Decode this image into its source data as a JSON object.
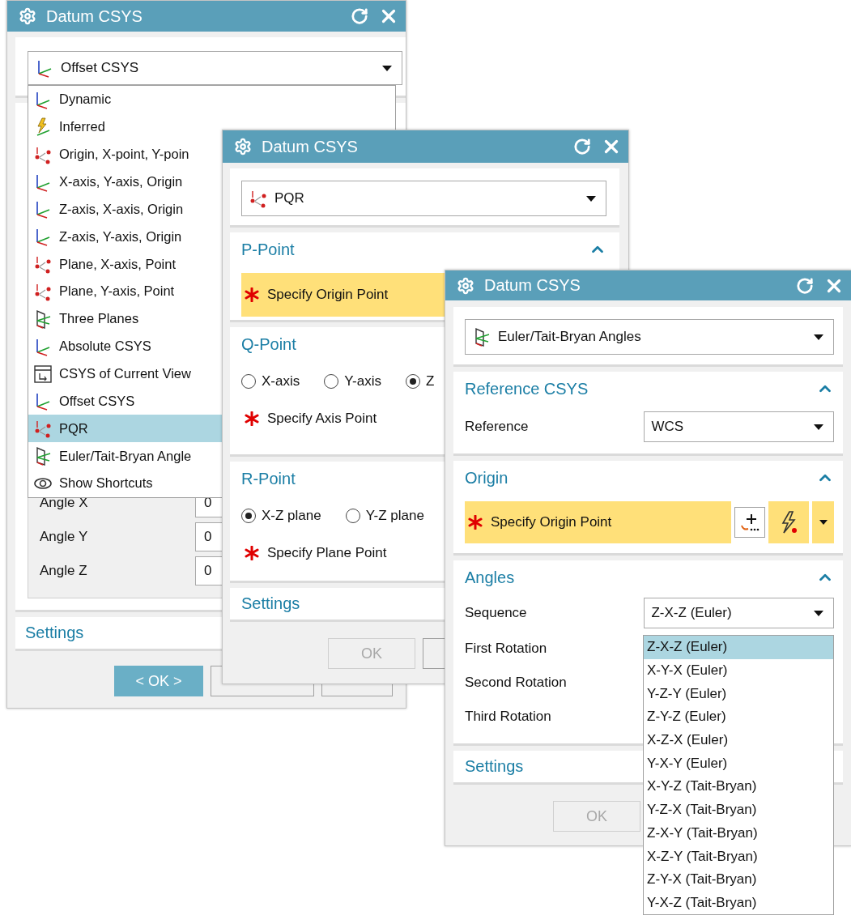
{
  "offset_window": {
    "title": "Datum CSYS",
    "type_value": "Offset CSYS",
    "type_list": [
      {
        "label": "Dynamic",
        "selected": false
      },
      {
        "label": "Inferred",
        "selected": false
      },
      {
        "label": "Origin, X-point, Y-poin",
        "selected": false
      },
      {
        "label": "X-axis, Y-axis, Origin",
        "selected": false
      },
      {
        "label": "Z-axis, X-axis, Origin",
        "selected": false
      },
      {
        "label": "Z-axis, Y-axis, Origin",
        "selected": false
      },
      {
        "label": "Plane, X-axis, Point",
        "selected": false
      },
      {
        "label": "Plane, Y-axis, Point",
        "selected": false
      },
      {
        "label": "Three Planes",
        "selected": false
      },
      {
        "label": "Absolute CSYS",
        "selected": false
      },
      {
        "label": "CSYS of Current View",
        "selected": false
      },
      {
        "label": "Offset CSYS",
        "selected": false
      },
      {
        "label": "PQR",
        "selected": true
      },
      {
        "label": "Euler/Tait-Bryan Angle",
        "selected": false
      },
      {
        "label": "Show Shortcuts",
        "selected": false
      }
    ],
    "angles": [
      {
        "label": "Angle X",
        "value": "0"
      },
      {
        "label": "Angle Y",
        "value": "0"
      },
      {
        "label": "Angle Z",
        "value": "0"
      }
    ],
    "settings_label": "Settings",
    "buttons": [
      {
        "label": "< OK >",
        "default": true
      },
      {
        "default": false
      },
      {
        "default": false
      }
    ]
  },
  "pqr_window": {
    "title": "Datum CSYS",
    "type_value": "PQR",
    "sections": [
      {
        "title": "P-Point",
        "expanded": true,
        "prompt": "Specify Origin Point",
        "active": true
      },
      {
        "title": "Q-Point",
        "options": [
          {
            "label": "X-axis",
            "selected": false
          },
          {
            "label": "Y-axis",
            "selected": false
          },
          {
            "label": "Z",
            "selected": true
          }
        ],
        "prompt": "Specify Axis Point",
        "active": false
      },
      {
        "title": "R-Point",
        "options": [
          {
            "label": "X-Z plane",
            "selected": true
          },
          {
            "label": "Y-Z plane",
            "selected": false
          }
        ],
        "prompt": "Specify Plane Point",
        "active": false
      }
    ],
    "settings_label": "Settings",
    "buttons": [
      {
        "label": "OK",
        "disabled": true
      },
      {
        "disabled": false
      }
    ]
  },
  "euler_window": {
    "title": "Datum CSYS",
    "type_value": "Euler/Tait-Bryan Angles",
    "reference_section": {
      "title": "Reference CSYS",
      "expanded": true,
      "label": "Reference",
      "value": "WCS"
    },
    "origin_section": {
      "title": "Origin",
      "expanded": true,
      "prompt": "Specify Origin Point",
      "active": true
    },
    "angles_section": {
      "title": "Angles",
      "expanded": true,
      "sequence_label": "Sequence",
      "sequence_value": "Z-X-Z (Euler)",
      "sequence_options": [
        {
          "label": "Z-X-Z (Euler)",
          "selected": true
        },
        {
          "label": "X-Y-X (Euler)",
          "selected": false
        },
        {
          "label": "Y-Z-Y (Euler)",
          "selected": false
        },
        {
          "label": "Z-Y-Z (Euler)",
          "selected": false
        },
        {
          "label": "X-Z-X (Euler)",
          "selected": false
        },
        {
          "label": "Y-X-Y (Euler)",
          "selected": false
        },
        {
          "label": "X-Y-Z (Tait-Bryan)",
          "selected": false
        },
        {
          "label": "Y-Z-X (Tait-Bryan)",
          "selected": false
        },
        {
          "label": "Z-X-Y (Tait-Bryan)",
          "selected": false
        },
        {
          "label": "X-Z-Y (Tait-Bryan)",
          "selected": false
        },
        {
          "label": "Z-Y-X (Tait-Bryan)",
          "selected": false
        },
        {
          "label": "Y-X-Z (Tait-Bryan)",
          "selected": false
        }
      ],
      "rotation_labels": [
        "First Rotation",
        "Second Rotation",
        "Third Rotation"
      ]
    },
    "settings_label": "Settings",
    "buttons": [
      {
        "label": "OK",
        "disabled": true
      }
    ]
  }
}
